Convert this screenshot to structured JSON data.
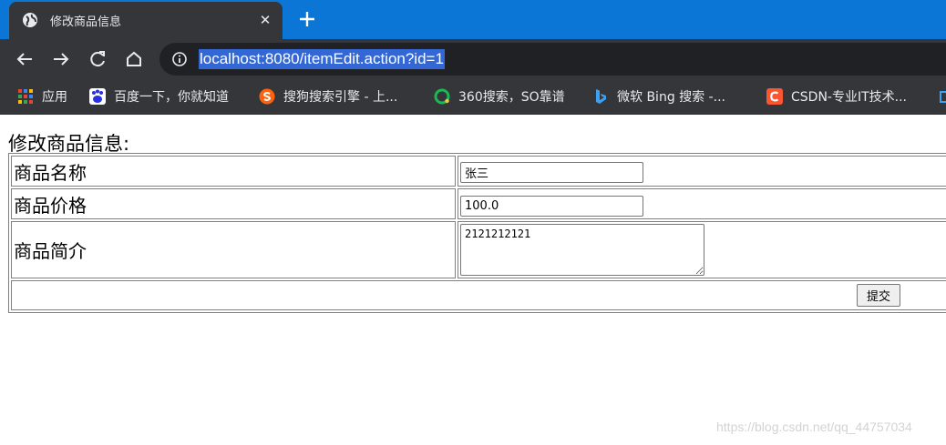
{
  "browser": {
    "tab_title": "修改商品信息",
    "tab_close": "✕",
    "url": "localhost:8080/itemEdit.action?id=1",
    "bookmarks": [
      {
        "label": "应用",
        "icon": "apps-grid-icon"
      },
      {
        "label": "百度一下，你就知道",
        "icon": "baidu-paw-icon"
      },
      {
        "label": "搜狗搜索引擎 - 上...",
        "icon": "sogou-icon"
      },
      {
        "label": "360搜索，SO靠谱",
        "icon": "so360-icon"
      },
      {
        "label": "微软 Bing 搜索 -...",
        "icon": "bing-icon"
      },
      {
        "label": "CSDN-专业IT技术...",
        "icon": "csdn-icon"
      }
    ]
  },
  "page": {
    "heading": "修改商品信息:",
    "form": {
      "rows": [
        {
          "label": "商品名称",
          "value": "张三"
        },
        {
          "label": "商品价格",
          "value": "100.0"
        },
        {
          "label": "商品简介",
          "value": "2121212121"
        }
      ],
      "submit_label": "提交"
    },
    "watermark": "https://blog.csdn.net/qq_44757034"
  },
  "colors": {
    "tab_strip": "#0b76d5",
    "chrome_dark": "#35363a",
    "omnibox_bg": "#202124",
    "url_selection": "#3367d6"
  }
}
